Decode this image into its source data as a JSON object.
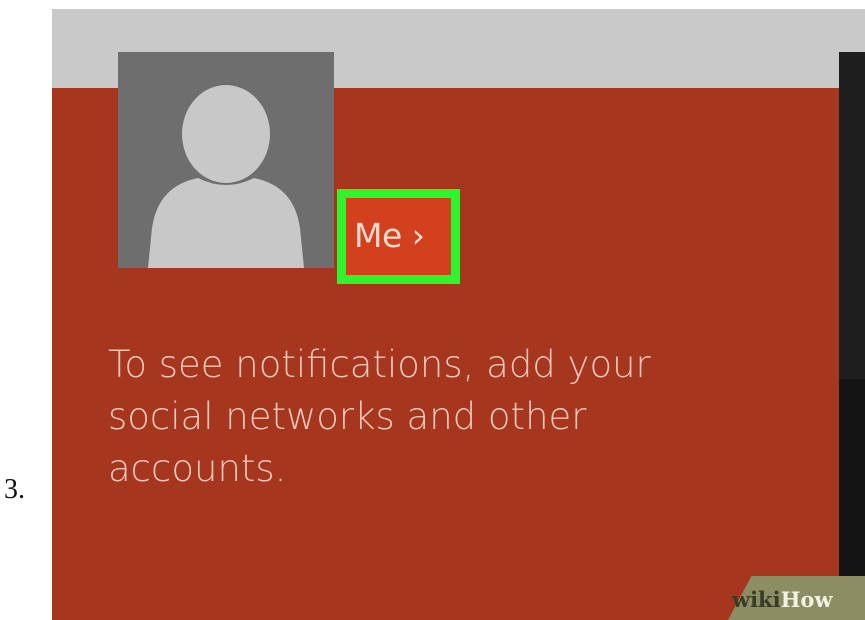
{
  "step": {
    "number": "3."
  },
  "profile": {
    "avatar_icon": "user-silhouette-icon",
    "me_label": "Me ›"
  },
  "notifications": {
    "message": "To see notifications, add your\nsocial networks and other\naccounts."
  },
  "watermark": {
    "wiki": "wiki",
    "how": "How"
  },
  "colors": {
    "background": "#a6361e",
    "top_strip": "#c9c9c9",
    "highlight_border": "#2ef52e",
    "me_tile": "#d2401e",
    "avatar_bg": "#6e6e6e",
    "avatar_figure": "#c8c8c8",
    "text": "#eec8bb"
  }
}
